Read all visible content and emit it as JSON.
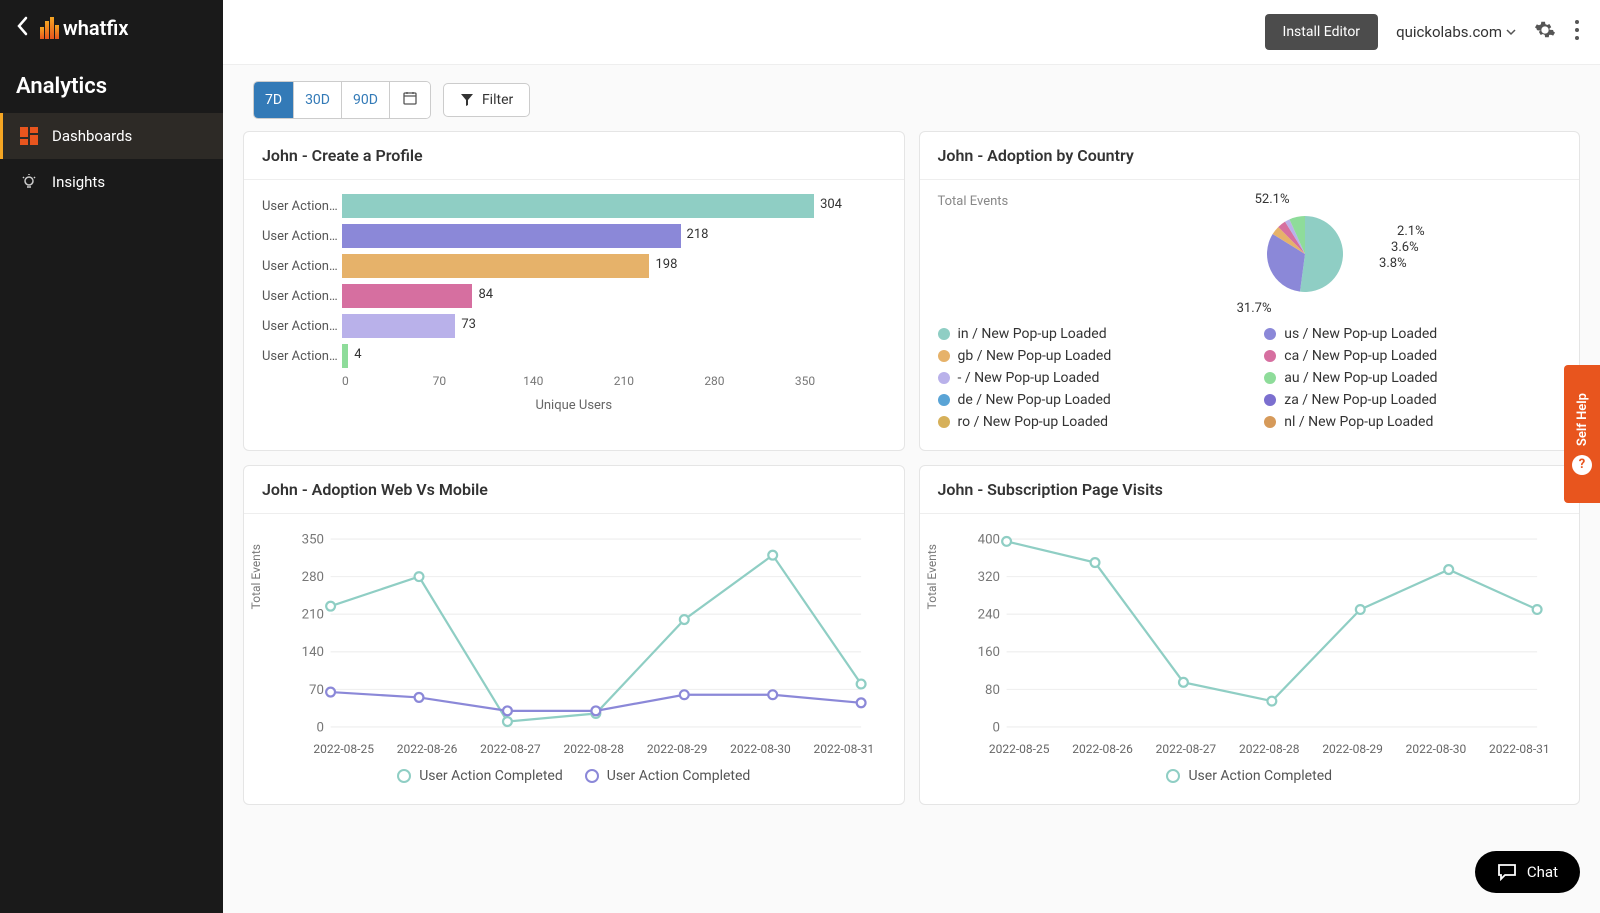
{
  "sidebar": {
    "title": "Analytics",
    "items": [
      {
        "label": "Dashboards",
        "active": true
      },
      {
        "label": "Insights",
        "active": false
      }
    ]
  },
  "topbar": {
    "install_label": "Install Editor",
    "domain": "quickolabs.com"
  },
  "toolbar": {
    "ranges": [
      "7D",
      "30D",
      "90D"
    ],
    "active_range": "7D",
    "filter_label": "Filter"
  },
  "cards": {
    "profile": {
      "title": "John - Create a Profile"
    },
    "country": {
      "title": "John - Adoption by Country",
      "side_label": "Total Events"
    },
    "webmobile": {
      "title": "John - Adoption Web Vs Mobile"
    },
    "subs": {
      "title": "John - Subscription Page Visits"
    }
  },
  "chart_data": {
    "profile": {
      "type": "bar",
      "xlabel": "Unique Users",
      "x_ticks": [
        0,
        70,
        140,
        210,
        280,
        350
      ],
      "xlim": [
        0,
        350
      ],
      "series": [
        {
          "label": "User Action…",
          "value": 304,
          "color": "#8fcec4"
        },
        {
          "label": "User Action…",
          "value": 218,
          "color": "#8b88d8"
        },
        {
          "label": "User Action…",
          "value": 198,
          "color": "#e6b26a"
        },
        {
          "label": "User Action…",
          "value": 84,
          "color": "#d66fa0"
        },
        {
          "label": "User Action…",
          "value": 73,
          "color": "#b9b1ea"
        },
        {
          "label": "User Action…",
          "value": 4,
          "color": "#8edc9a"
        }
      ]
    },
    "country": {
      "type": "pie",
      "callouts": [
        "52.1%",
        "2.1%",
        "3.6%",
        "3.8%",
        "31.7%"
      ],
      "legend": [
        {
          "label": "in / New Pop-up Loaded",
          "color": "#8fcec4"
        },
        {
          "label": "us / New Pop-up Loaded",
          "color": "#8b88d8"
        },
        {
          "label": "gb / New Pop-up Loaded",
          "color": "#e6b26a"
        },
        {
          "label": "ca / New Pop-up Loaded",
          "color": "#d66fa0"
        },
        {
          "label": "- / New Pop-up Loaded",
          "color": "#b9b1ea"
        },
        {
          "label": "au / New Pop-up Loaded",
          "color": "#8edc9a"
        },
        {
          "label": "de / New Pop-up Loaded",
          "color": "#5aa4d6"
        },
        {
          "label": "za / New Pop-up Loaded",
          "color": "#7b6fcf"
        },
        {
          "label": "ro / New Pop-up Loaded",
          "color": "#d6b05a"
        },
        {
          "label": "nl / New Pop-up Loaded",
          "color": "#d69a5a"
        }
      ],
      "slices": [
        {
          "value": 52.1,
          "color": "#8fcec4"
        },
        {
          "value": 31.7,
          "color": "#8b88d8"
        },
        {
          "value": 3.8,
          "color": "#e6b26a"
        },
        {
          "value": 3.6,
          "color": "#d66fa0"
        },
        {
          "value": 2.1,
          "color": "#b9b1ea"
        },
        {
          "value": 6.7,
          "color": "#8edc9a"
        }
      ]
    },
    "webmobile": {
      "type": "line",
      "ylabel": "Total Events",
      "y_ticks": [
        0,
        70,
        140,
        210,
        280,
        350
      ],
      "ylim": [
        0,
        350
      ],
      "x": [
        "2022-08-25",
        "2022-08-26",
        "2022-08-27",
        "2022-08-28",
        "2022-08-29",
        "2022-08-30",
        "2022-08-31"
      ],
      "series": [
        {
          "name": "User Action Completed",
          "color": "#8fcec4",
          "values": [
            225,
            280,
            10,
            25,
            200,
            320,
            80
          ]
        },
        {
          "name": "User Action Completed",
          "color": "#8b88d8",
          "values": [
            65,
            55,
            30,
            30,
            60,
            60,
            45
          ]
        }
      ]
    },
    "subs": {
      "type": "line",
      "ylabel": "Total Events",
      "y_ticks": [
        0,
        80,
        160,
        240,
        320,
        400
      ],
      "ylim": [
        0,
        400
      ],
      "x": [
        "2022-08-25",
        "2022-08-26",
        "2022-08-27",
        "2022-08-28",
        "2022-08-29",
        "2022-08-30",
        "2022-08-31"
      ],
      "series": [
        {
          "name": "User Action Completed",
          "color": "#8fcec4",
          "values": [
            395,
            350,
            95,
            55,
            250,
            335,
            250
          ]
        }
      ]
    }
  },
  "self_help": {
    "label": "Self Help"
  },
  "chat": {
    "label": "Chat"
  }
}
